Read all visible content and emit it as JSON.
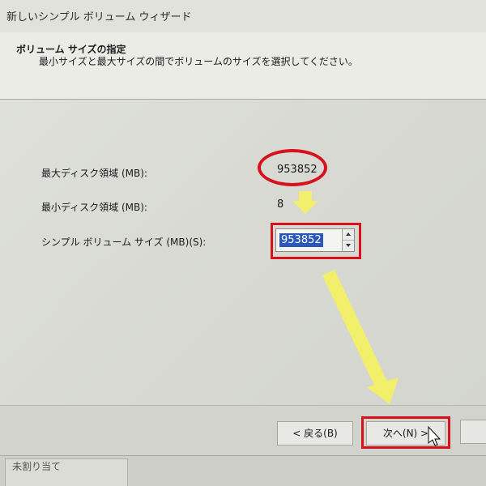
{
  "window": {
    "title": "新しいシンプル ボリューム ウィザード"
  },
  "header": {
    "title": "ボリューム サイズの指定",
    "subtitle": "最小サイズと最大サイズの間でボリュームのサイズを選択してください。"
  },
  "fields": {
    "max_label": "最大ディスク領域 (MB):",
    "max_value": "953852",
    "min_label": "最小ディスク領域 (MB):",
    "min_value": "8",
    "size_label": "シンプル ボリューム サイズ (MB)(S):",
    "size_value": "953852"
  },
  "buttons": {
    "back": "< 戻る(B)",
    "next": "次へ(N) >"
  },
  "background_window": {
    "text": "未割り当て"
  },
  "colors": {
    "highlight_red": "#d8121c",
    "arrow_yellow": "#f2ef6a",
    "selection_blue": "#2b58b8"
  },
  "icons": {
    "spin_up": "triangle-up",
    "spin_down": "triangle-down",
    "cursor": "mouse-pointer"
  }
}
